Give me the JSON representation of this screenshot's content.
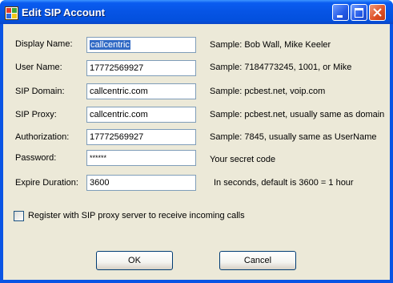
{
  "window": {
    "title": "Edit SIP Account",
    "icon": "app-icon",
    "controls": [
      "minimize-icon",
      "maximize-icon",
      "close-icon"
    ]
  },
  "form": {
    "display_name": {
      "label": "Display Name:",
      "value": "callcentric",
      "sample": "Sample: Bob Wall, Mike Keeler"
    },
    "user_name": {
      "label": "User Name:",
      "value": "17772569927",
      "sample": "Sample: 7184773245, 1001, or Mike"
    },
    "sip_domain": {
      "label": "SIP Domain:",
      "value": "callcentric.com",
      "sample": "Sample: pcbest.net, voip.com"
    },
    "sip_proxy": {
      "label": "SIP Proxy:",
      "value": "callcentric.com",
      "sample": "Sample: pcbest.net, usually same as domain"
    },
    "authorization": {
      "label": "Authorization:",
      "value": "17772569927",
      "sample": "Sample: 7845, usually same as UserName"
    },
    "password": {
      "label": "Password:",
      "value": "******",
      "sample": "Your secret code"
    },
    "expire_duration": {
      "label": "Expire Duration:",
      "value": "3600",
      "sample": "In seconds, default is 3600 = 1 hour"
    }
  },
  "register_checkbox": {
    "label": "Register with SIP proxy server to receive incoming calls",
    "checked": false
  },
  "buttons": {
    "ok": "OK",
    "cancel": "Cancel"
  },
  "colors": {
    "titlebar": "#0654e4",
    "client_bg": "#ece9d8",
    "selection": "#316ac5",
    "input_border": "#7f9db9"
  }
}
